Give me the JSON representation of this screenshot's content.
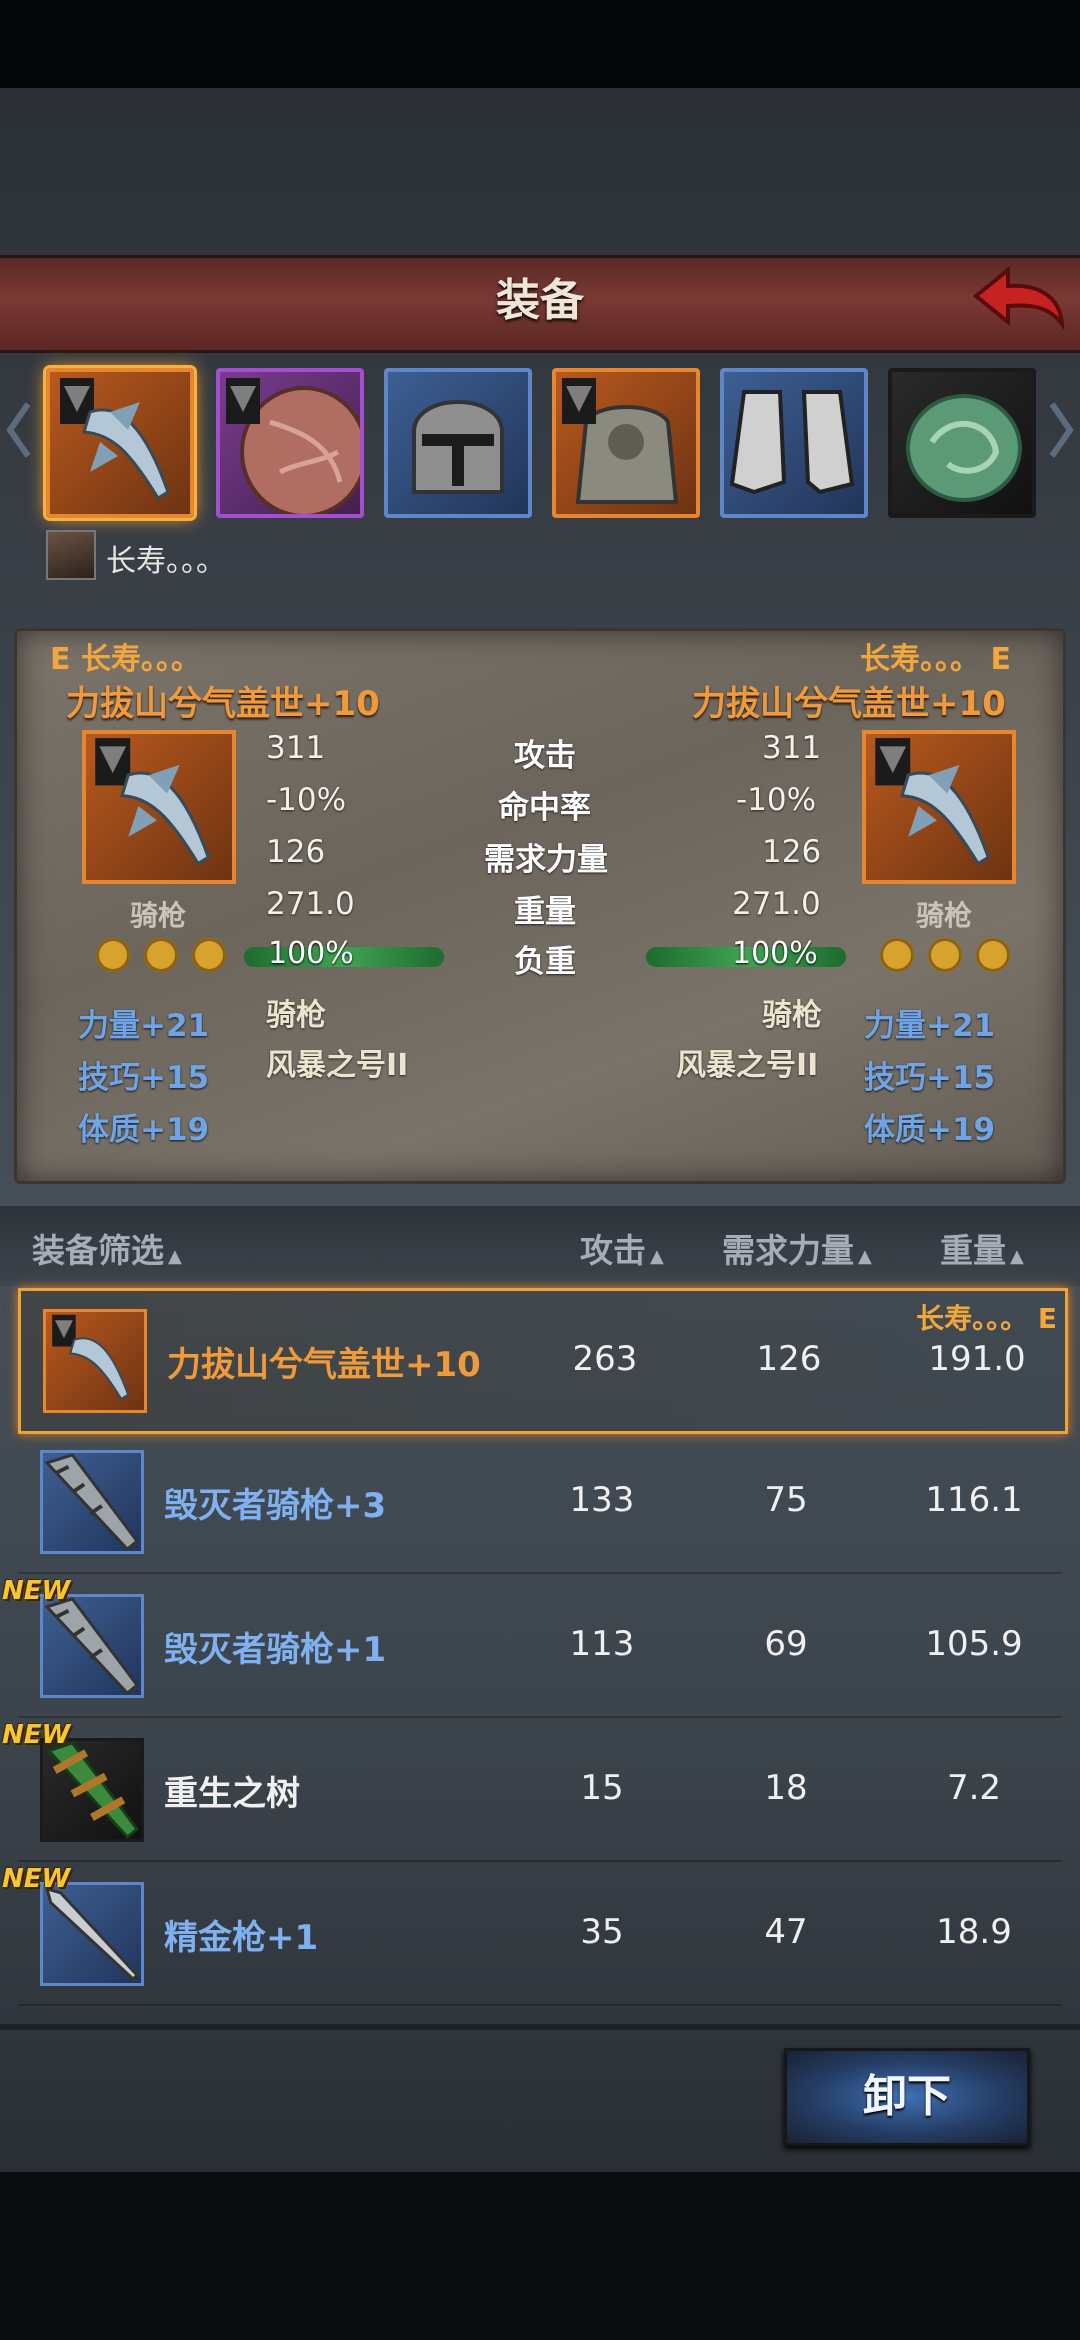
{
  "screen": {
    "title": "装备"
  },
  "character": {
    "name": "长寿。。。"
  },
  "slots": [
    {
      "name": "weapon",
      "rarity": "orange",
      "selected": true
    },
    {
      "name": "shield",
      "rarity": "purple"
    },
    {
      "name": "helmet",
      "rarity": "blue"
    },
    {
      "name": "armor",
      "rarity": "orange"
    },
    {
      "name": "boots",
      "rarity": "blue"
    },
    {
      "name": "accessory",
      "rarity": "black"
    }
  ],
  "compare": {
    "left_owner": "E 长寿。。。",
    "right_owner": "长寿。。。 E",
    "left_item": "力拔山兮气盖世+10",
    "right_item": "力拔山兮气盖世+10",
    "left_type": "骑枪",
    "right_type": "骑枪",
    "stats": [
      {
        "label": "攻击",
        "left": "311",
        "right": "311"
      },
      {
        "label": "命中率",
        "left": "-10%",
        "right": "-10%"
      },
      {
        "label": "需求力量",
        "left": "126",
        "right": "126"
      },
      {
        "label": "重量",
        "left": "271.0",
        "right": "271.0"
      }
    ],
    "load": {
      "label": "负重",
      "left": "100%",
      "right": "100%",
      "left_fraction": 1.0,
      "right_fraction": 1.0
    },
    "left_traits": [
      "骑枪",
      "风暴之号II"
    ],
    "right_traits": [
      "骑枪",
      "风暴之号II"
    ],
    "left_bonuses": [
      "力量+21",
      "技巧+15",
      "体质+19"
    ],
    "right_bonuses": [
      "力量+21",
      "技巧+15",
      "体质+19"
    ],
    "stars": 3
  },
  "list_header": {
    "filter": "装备筛选",
    "attack": "攻击",
    "strength": "需求力量",
    "weight": "重量"
  },
  "items": [
    {
      "name": "力拔山兮气盖世+10",
      "attack": "263",
      "strength": "126",
      "weight": "191.0",
      "owner": "长寿。。。 E",
      "rarity": "orange",
      "is_new": false
    },
    {
      "name": "毁灭者骑枪+3",
      "attack": "133",
      "strength": "75",
      "weight": "116.1",
      "rarity": "blue",
      "is_new": false
    },
    {
      "name": "毁灭者骑枪+1",
      "attack": "113",
      "strength": "69",
      "weight": "105.9",
      "rarity": "blue",
      "is_new": true
    },
    {
      "name": "重生之树",
      "attack": "15",
      "strength": "18",
      "weight": "7.2",
      "rarity": "black",
      "is_new": true
    },
    {
      "name": "精金枪+1",
      "attack": "35",
      "strength": "47",
      "weight": "18.9",
      "rarity": "blue",
      "is_new": true
    }
  ],
  "new_badge": "NEW",
  "actions": {
    "unequip": "卸下"
  },
  "colors": {
    "accent_orange": "#e6862f",
    "rarity_blue": "#5d87c8",
    "rarity_purple": "#a44fd0",
    "header_red": "#7b3934"
  }
}
